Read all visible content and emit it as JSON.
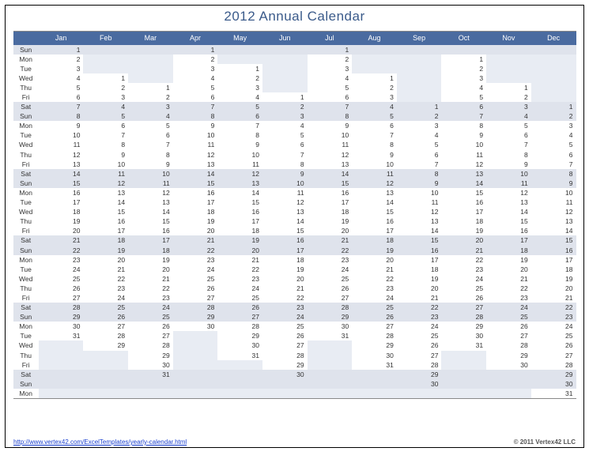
{
  "title": "2012 Annual Calendar",
  "months": [
    "Jan",
    "Feb",
    "Mar",
    "Apr",
    "May",
    "Jun",
    "Jul",
    "Aug",
    "Sep",
    "Oct",
    "Nov",
    "Dec"
  ],
  "day_names": [
    "Sun",
    "Mon",
    "Tue",
    "Wed",
    "Thu",
    "Fri",
    "Sat"
  ],
  "year": 2012,
  "month_start_dow": [
    0,
    3,
    4,
    0,
    2,
    5,
    0,
    3,
    6,
    1,
    4,
    6
  ],
  "month_lengths": [
    31,
    29,
    31,
    30,
    31,
    30,
    31,
    31,
    30,
    31,
    30,
    31
  ],
  "grid_rows": 37,
  "footer_link_url": "http://www.vertex42.com/ExcelTemplates/yearly-calendar.html",
  "footer_link_text": "http://www.vertex42.com/ExcelTemplates/yearly-calendar.html",
  "copyright": "© 2011 Vertex42 LLC"
}
